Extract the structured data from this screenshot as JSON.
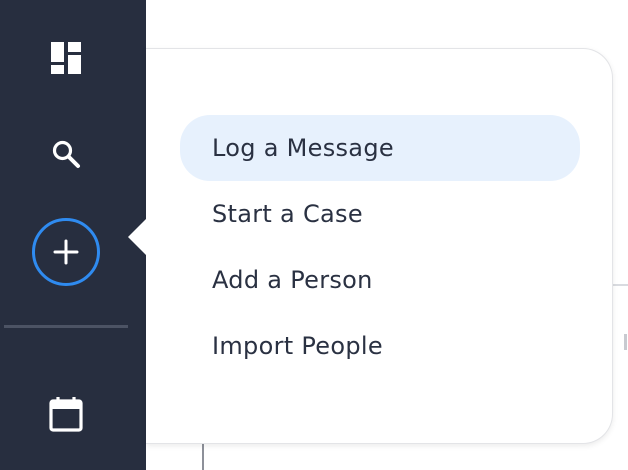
{
  "sidebar": {
    "items": [
      {
        "name": "dashboard",
        "icon": "dashboard-icon"
      },
      {
        "name": "search",
        "icon": "search-icon"
      },
      {
        "name": "create",
        "icon": "plus-icon",
        "active": true
      },
      {
        "name": "calendar",
        "icon": "calendar-icon"
      }
    ]
  },
  "create_menu": {
    "items": [
      {
        "label": "Log a Message",
        "highlighted": true
      },
      {
        "label": "Start a Case"
      },
      {
        "label": "Add a Person"
      },
      {
        "label": "Import People"
      }
    ]
  },
  "colors": {
    "sidebar_bg": "#272e3f",
    "accent": "#2f8bf0",
    "menu_highlight": "#e7f1fd",
    "menu_text": "#2a3142"
  }
}
